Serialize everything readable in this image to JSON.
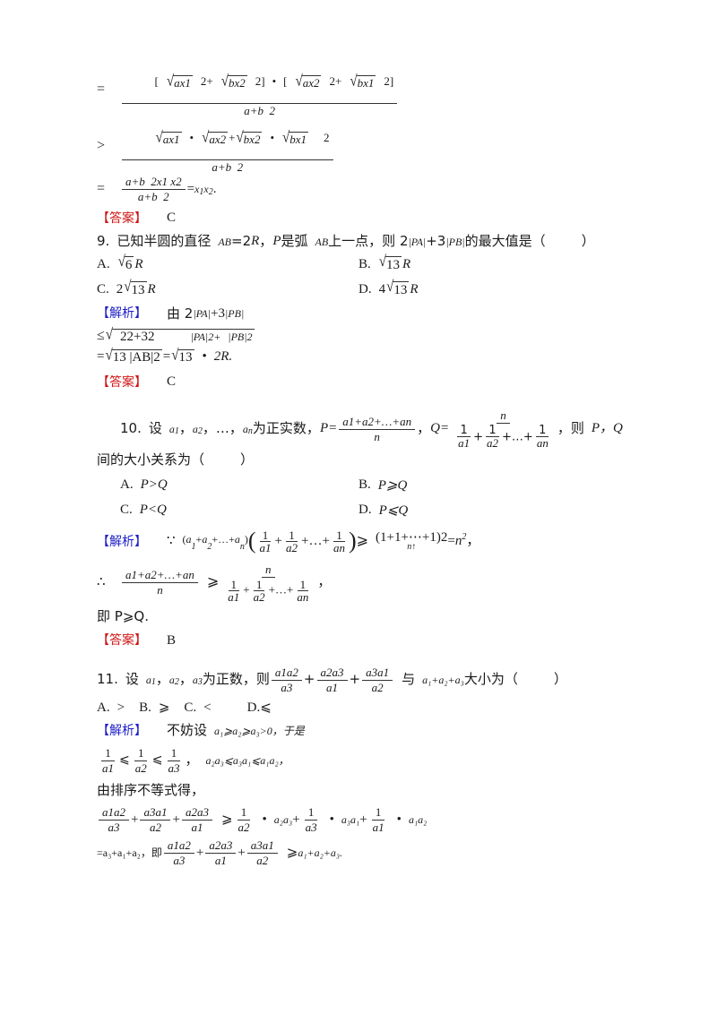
{
  "page": {
    "background": "#ffffff",
    "text_color": "#1a1a1a",
    "jiexi_color": "#2020c8",
    "daan_color": "#d01515",
    "labels": {
      "jiexi": "【解析】",
      "daan": "【答案】"
    }
  },
  "q8_tail": {
    "eq1": {
      "eq_sign": "=",
      "numerator": "[ √ax1  2+  √bx2  2] • [ √ax2  2+  √bx1  2]",
      "denominator": "a+b  2",
      "num_parts": {
        "lb1": "[",
        "r1": "ax1",
        "p1": "2+",
        "r2": "bx2",
        "p2": "2]",
        "dot": "•",
        "lb2": "[",
        "r3": "ax2",
        "p3": "2+",
        "r4": "bx1",
        "p4": "2]"
      },
      "den_text": "a+b  2"
    },
    "eq2": {
      "rel": ">",
      "num_parts": {
        "r1": "ax1",
        "dot1": "•",
        "r2": "ax2",
        "plus": "+",
        "r3": "bx2",
        "dot2": "•",
        "r4": "bx1",
        "tail": "2"
      },
      "den_text": "a+b  2"
    },
    "eq3": {
      "eq_sign": "=",
      "num_text": "a+b  2x1 x2",
      "den_text": "a+b  2",
      "result_eq": "=",
      "result": "x",
      "result_sub1": "1",
      "result_var2": "x",
      "result_sub2": "2",
      "period": "."
    },
    "answer": "C"
  },
  "q9": {
    "number": "9.",
    "stem_1": "已知半圆的直径",
    "stem_var_ab": "AB",
    "stem_eq": "=2",
    "stem_R": "R",
    "stem_2": "，",
    "stem_P": "P",
    "stem_3": "是弧",
    "stem_AB2": "AB",
    "stem_4": "上一点，则 2",
    "stem_PA": "|PA|",
    "stem_plus": "+3",
    "stem_PB": "|PB|",
    "stem_5": "的最大值是（",
    "stem_6": "）",
    "options": [
      {
        "key": "A.",
        "radicand": "6",
        "tail": "R",
        "coef": ""
      },
      {
        "key": "B.",
        "radicand": "13",
        "tail": "R",
        "coef": ""
      },
      {
        "key": "C.",
        "radicand": "13",
        "tail": "R",
        "coef": "2"
      },
      {
        "key": "D.",
        "radicand": "13",
        "tail": "R",
        "coef": "4"
      }
    ],
    "solution": {
      "line1_prefix": "由 2",
      "line1_pa": "|PA|",
      "line1_mid": "+3",
      "line1_pb": "|PB|",
      "line2_rel": "≤",
      "line2_radicand": "22+32      |PA|2+ |PB|2",
      "line2_parts": {
        "a": "22+32",
        "b": "|PA|2+",
        "c": "|PB|2"
      },
      "line3": {
        "eq": "=",
        "rad1": "13 |AB|2",
        "mid": "=",
        "rad2": "13",
        "dot": "•",
        "tail": "2R."
      }
    },
    "answer": "C"
  },
  "q10": {
    "number": "10.",
    "stem_1": "设",
    "a1": "a",
    "a1s": "1",
    "a2": "a",
    "a2s": "2",
    "dots": "…",
    "an": "a",
    "ans": "n",
    "stem_2": "为正实数，",
    "P": "P=",
    "P_num": "a1+a2+…+an",
    "P_den": "n",
    "comma": "，",
    "Q": "Q=",
    "Q_num": "n",
    "Q_den_parts": {
      "f1": "1/a1",
      "plus1": "+",
      "f2": "1/a2",
      "plus2": "+…+",
      "f3": "1/an"
    },
    "stem_3": "，则",
    "PQ": "P，Q",
    "stem_line2": "间的大小关系为（",
    "stem_line2_end": "）",
    "options": [
      {
        "key": "A.",
        "text": "P>Q"
      },
      {
        "key": "B.",
        "text": "P⩾Q"
      },
      {
        "key": "C.",
        "text": "P<Q"
      },
      {
        "key": "D.",
        "text": "P⩽Q"
      }
    ],
    "solution": {
      "because": "∵",
      "lhs": "(a₁+a₂+…+aₙ)",
      "lhs_parts": {
        "open": "(",
        "a1": "a",
        "s1": "1",
        "p1": "+",
        "a2": "a",
        "s2": "2",
        "p2": "+…+",
        "an": "a",
        "sn": "n",
        "close": ")"
      },
      "paren_open": "(",
      "paren_close": ")",
      "inner": {
        "f1": "1/a1",
        "plus1": "+",
        "f2": "1/a2",
        "plus2": "+…+",
        "f3": "1/an"
      },
      "rel": "⩾",
      "rhs": "(1+1+⋯+1)2",
      "rhs_under": "n",
      "rhs_arrow": "↑",
      "equals": "=",
      "result": "n",
      "result_sup": "2",
      "result_tail": "，",
      "therefore": "∴",
      "line2_left_num": "a1+a2+…+an",
      "line2_left_den": "n",
      "line2_rel": "⩾",
      "line2_right_num": "n",
      "line2_right_den": {
        "f1": "1/a1",
        "plus1": "+",
        "f2": "1/a2",
        "plus2": "+…+",
        "f3": "1/an"
      },
      "line2_tail": "，",
      "line3": "即 P⩾Q."
    },
    "answer": "B"
  },
  "q11": {
    "number": "11.",
    "stem_1": "设",
    "a1": "a",
    "a1s": "1",
    "a2": "a",
    "a2s": "2",
    "a3": "a",
    "a3s": "3",
    "stem_2": "为正数，则",
    "fracs": [
      {
        "num": "a1a2",
        "den": "a3"
      },
      {
        "num": "a2a3",
        "den": "a1"
      },
      {
        "num": "a3a1",
        "den": "a2"
      }
    ],
    "plus": "+",
    "stem_3": "与",
    "sum_text": "a₁+a₂+a₃",
    "stem_4": "大小为（",
    "stem_5": "）",
    "options": [
      {
        "key": "A.",
        "text": ">"
      },
      {
        "key": "B.",
        "text": "⩾"
      },
      {
        "key": "C.",
        "text": "<"
      },
      {
        "key": "D.",
        "text": "⩽"
      }
    ],
    "solution": {
      "line1": "不妨设",
      "line1_ineq": "a₁⩾a₂⩾a₃>0，于是",
      "line2_fracs": [
        {
          "num": "1",
          "den": "a1"
        },
        {
          "num": "1",
          "den": "a2"
        },
        {
          "num": "1",
          "den": "a3"
        }
      ],
      "line2_rel": "⩽",
      "line2_tail": "，",
      "line2_second": "a₂a₃⩽a₃a₁⩽a₁a₂，",
      "line3": "由排序不等式得，",
      "line4_fracs": [
        {
          "num": "a1a2",
          "den": "a3"
        },
        {
          "num": "a3a1",
          "den": "a2"
        },
        {
          "num": "a2a3",
          "den": "a1"
        }
      ],
      "line4_rel": "⩾",
      "line4_terms": [
        {
          "frac_num": "1",
          "frac_den": "a2",
          "dot": "•",
          "prod": "a₂a₃",
          "op": "+"
        },
        {
          "frac_num": "1",
          "frac_den": "a3",
          "dot": "•",
          "prod": "a₃a₁",
          "op": "+"
        },
        {
          "frac_num": "1",
          "frac_den": "a1",
          "dot": "•",
          "prod": "a₁a₂",
          "op": ""
        }
      ],
      "line5_eq": "=a₃+a₁+a₂，即",
      "line5_fracs": [
        {
          "num": "a1a2",
          "den": "a3"
        },
        {
          "num": "a2a3",
          "den": "a1"
        },
        {
          "num": "a3a1",
          "den": "a2"
        }
      ],
      "line5_rel": "⩾",
      "line5_tail": "a₁+a₂+a₃."
    }
  }
}
